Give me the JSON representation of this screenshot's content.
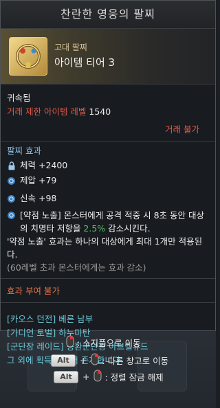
{
  "tooltip": {
    "title": "찬란한 영웅의 팔찌",
    "grade": "고대 팔찌",
    "tier": "아이템 티어 3",
    "bound": "귀속됨",
    "level_req_label": "거래 제한 아이템 레벨",
    "level_req_value": "1540",
    "trade_status": "거래 불가",
    "effect_header": "팔찌 효과",
    "stats": [
      {
        "icon": "lock-icon",
        "text": "체력 +2400"
      },
      {
        "icon": "swirl-icon",
        "text": "제압 +79"
      },
      {
        "icon": "swirl-icon",
        "text": "신속 +98"
      }
    ],
    "engrave": {
      "icon": "swirl-icon",
      "tag": "[약점 노출]",
      "text_1": " 몬스터에게 공격 적중 시 8초 동안 대상의 치명타 저항을 ",
      "highlight": "2.5%",
      "text_2": " 감소시킨다.",
      "line_2": "'약점 노출' 효과는 하나의 대상에게 최대 1개만 적용된다.",
      "note": "(60레벨 초과 몬스터에게는 효과 감소)"
    },
    "no_grant": "효과 부여 불가",
    "sources": [
      "[카오스 던전] 베른 남부",
      "[가디언 토벌] 하누마탄",
      "[군단장 레이드] 몽환군단장 아브렐슈드",
      "그 외에 획득처가 더 존재합니다."
    ]
  },
  "controls": [
    {
      "key": "",
      "label": ": 소지품으로 이동"
    },
    {
      "key": "Alt",
      "label": ": 다른 창고로 이동"
    },
    {
      "key": "Alt",
      "label": ": 정렬 잠금 해제"
    }
  ],
  "colors": {
    "accent_red": "#e15a4b",
    "accent_blue": "#8fc3ea",
    "highlight_green": "#58c26b",
    "source_cyan": "#6cc7d8"
  }
}
